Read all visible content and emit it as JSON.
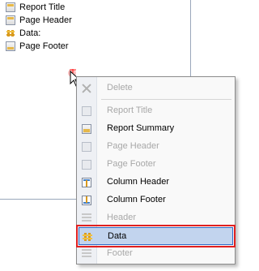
{
  "tree": {
    "items": [
      {
        "label": "Report Title",
        "icon": "report-title-band-icon"
      },
      {
        "label": "Page Header",
        "icon": "page-header-band-icon"
      },
      {
        "label": "Data:",
        "icon": "data-band-icon"
      },
      {
        "label": "Page Footer",
        "icon": "page-footer-band-icon"
      }
    ]
  },
  "context_menu": {
    "items": [
      {
        "label": "Delete",
        "enabled": false,
        "icon": "delete-icon"
      },
      {
        "label": "Report Title",
        "enabled": false,
        "icon": "report-title-icon"
      },
      {
        "label": "Report Summary",
        "enabled": true,
        "icon": "report-summary-icon"
      },
      {
        "label": "Page Header",
        "enabled": false,
        "icon": "page-header-icon"
      },
      {
        "label": "Page Footer",
        "enabled": false,
        "icon": "page-footer-icon"
      },
      {
        "label": "Column Header",
        "enabled": true,
        "icon": "column-header-icon"
      },
      {
        "label": "Column Footer",
        "enabled": true,
        "icon": "column-footer-icon"
      },
      {
        "label": "Header",
        "enabled": false,
        "icon": "header-icon"
      },
      {
        "label": "Data",
        "enabled": true,
        "selected": true,
        "icon": "data-icon"
      },
      {
        "label": "Footer",
        "enabled": false,
        "icon": "footer-icon"
      }
    ]
  },
  "colors": {
    "selection_fill": "#c2d4ee",
    "selection_border": "#316ac5",
    "highlight_outline": "#e02020",
    "disabled_text": "#a8a8a8"
  }
}
